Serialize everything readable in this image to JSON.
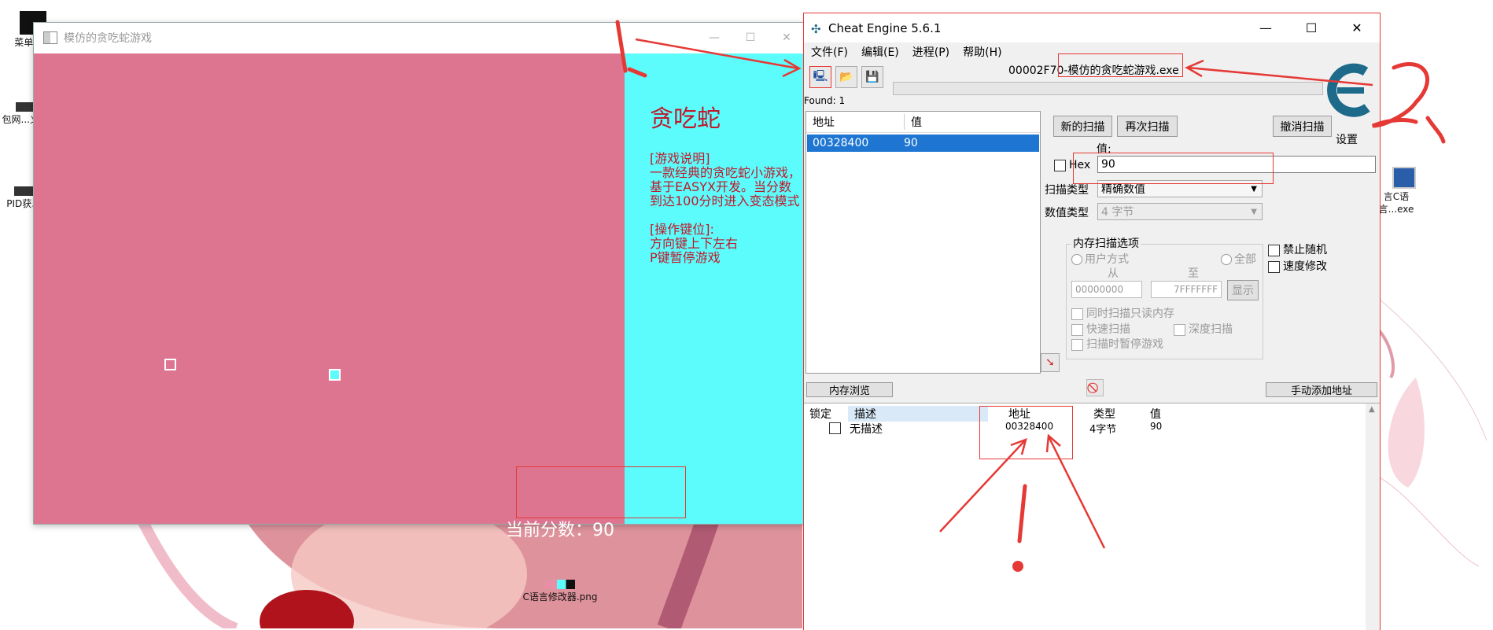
{
  "desktop": {
    "icons": [
      {
        "label": "菜单图..."
      },
      {
        "label": "包网...义..."
      },
      {
        "label": "PID获..."
      },
      {
        "label": "C语言修改器.png"
      },
      {
        "label": "言C语言...exe"
      }
    ]
  },
  "snake_window": {
    "title": "模仿的贪吃蛇游戏",
    "game_title": "贪吃蛇",
    "description": "[游戏说明]\n一款经典的贪吃蛇小游戏，基于EASYX开发。当分数到达100分时进入变态模式\n\n[操作键位]:\n方向键上下左右\nP键暂停游戏",
    "score_label": "当前分数：90",
    "colors": {
      "play_area": "#dd7591",
      "panel": "#5cfcfc",
      "text": "#c0182a"
    }
  },
  "annotations": {
    "labels": [
      "1",
      "2",
      "!"
    ]
  },
  "cheat_engine": {
    "title": "Cheat Engine 5.6.1",
    "menu": [
      "文件(F)",
      "编辑(E)",
      "进程(P)",
      "帮助(H)"
    ],
    "process": "00002F70-模仿的贪吃蛇游戏.exe",
    "found": "Found: 1",
    "results": {
      "headers": [
        "地址",
        "值"
      ],
      "rows": [
        {
          "address": "00328400",
          "value": "90"
        }
      ]
    },
    "buttons": {
      "new_scan": "新的扫描",
      "next_scan": "再次扫描",
      "undo_scan": "撤消扫描",
      "settings": "设置",
      "memory_view": "内存浏览",
      "add_address": "手动添加地址",
      "show": "显示"
    },
    "value_label": "值:",
    "hex_label": "Hex",
    "value_input": "90",
    "scan_type_label": "扫描类型",
    "scan_type": "精确数值",
    "value_type_label": "数值类型",
    "value_type": "4 字节",
    "mem_options": {
      "title": "内存扫描选项",
      "user_mode": "用户方式",
      "all": "全部",
      "from_label": "从",
      "to_label": "至",
      "from": "00000000",
      "to": "7FFFFFFF",
      "readonly": "同时扫描只读内存",
      "fast": "快速扫描",
      "deep": "深度扫描",
      "pause": "扫描时暂停游戏"
    },
    "no_random": "禁止随机",
    "speedhack": "速度修改",
    "address_table": {
      "headers": [
        "锁定",
        "描述",
        "地址",
        "类型",
        "值"
      ],
      "rows": [
        {
          "description": "无描述",
          "address": "00328400",
          "type": "4字节",
          "value": "90"
        }
      ]
    }
  }
}
